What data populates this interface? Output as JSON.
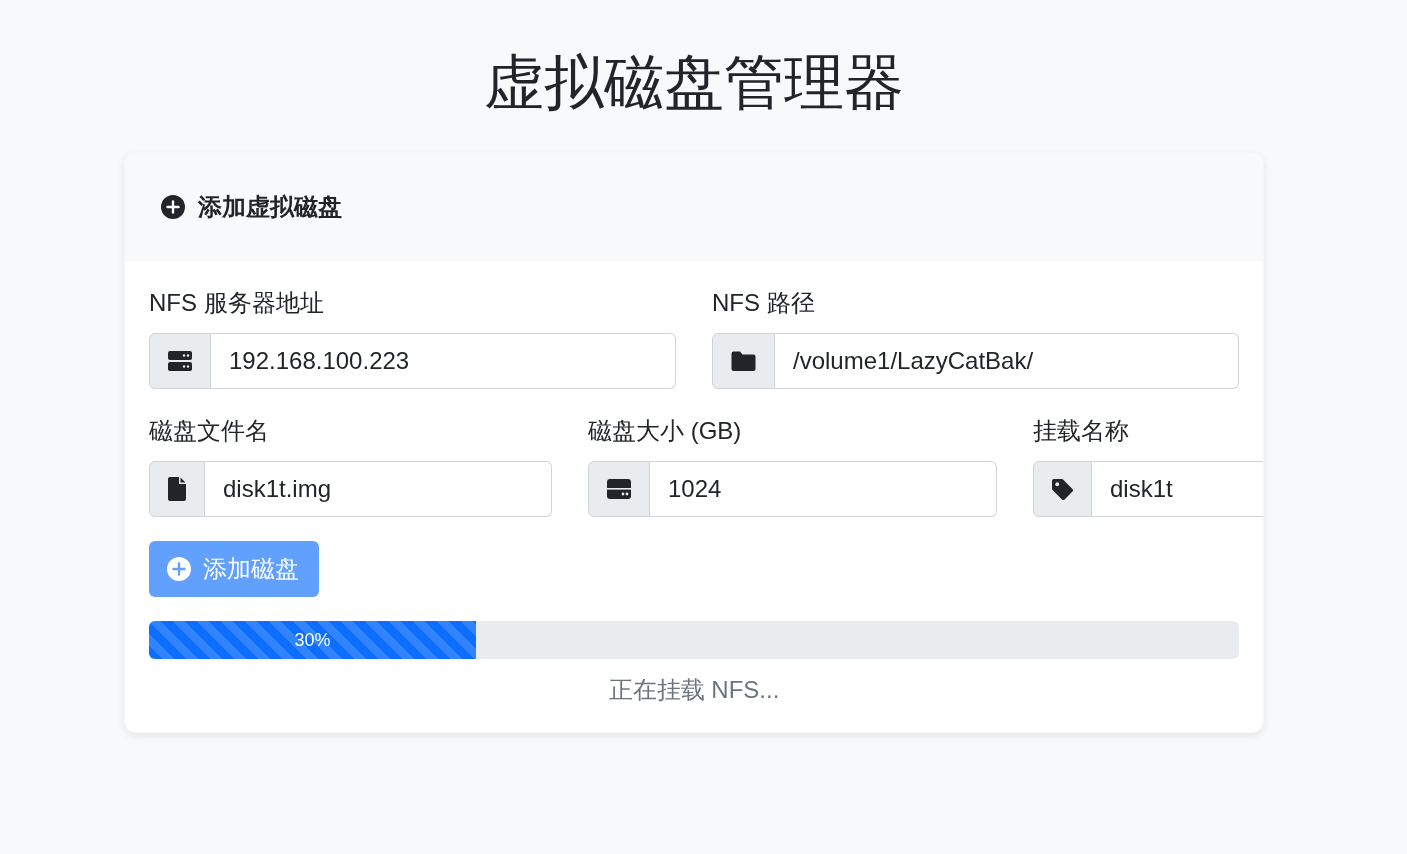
{
  "page": {
    "title": "虚拟磁盘管理器"
  },
  "card": {
    "header": {
      "title": "添加虚拟磁盘"
    },
    "form_rows": [
      {
        "fields": [
          {
            "label": "NFS 服务器地址",
            "value": "192.168.100.223"
          },
          {
            "label": "NFS 路径",
            "value": "/volume1/LazyCatBak/"
          }
        ]
      },
      {
        "fields": [
          {
            "label": "磁盘文件名",
            "value": "disk1t.img"
          },
          {
            "label": "磁盘大小 (GB)",
            "value": "1024"
          },
          {
            "label": "挂载名称",
            "value": "disk1t"
          }
        ]
      }
    ],
    "submit_button": {
      "label": "添加磁盘",
      "disabled": true
    },
    "progress": {
      "level": 0.3,
      "label": "30%"
    },
    "status": "正在挂载 NFS..."
  }
}
